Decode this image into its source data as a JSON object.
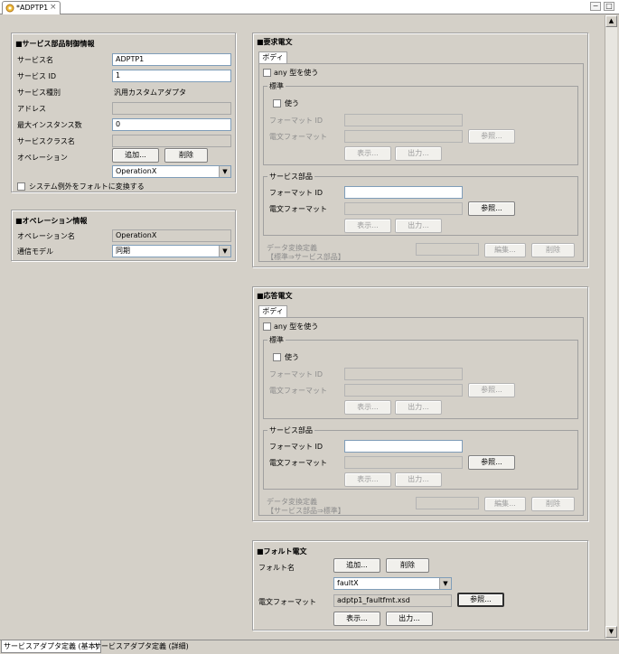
{
  "editor_tab": {
    "title": "*ADPTP1",
    "close_label": "×"
  },
  "service_info": {
    "title": "■サービス部品制御情報",
    "name_label": "サービス名",
    "name_value": "ADPTP1",
    "id_label": "サービス ID",
    "id_value": "1",
    "type_label": "サービス種別",
    "type_value": "汎用カスタムアダプタ",
    "address_label": "アドレス",
    "address_value": "",
    "max_instances_label": "最大インスタンス数",
    "max_instances_value": "0",
    "class_label": "サービスクラス名",
    "class_value": "",
    "operation_label": "オペレーション",
    "add_button": "追加...",
    "delete_button": "削除",
    "operation_selected": "OperationX",
    "fault_convert_label": "システム例外をフォルトに変換する"
  },
  "operation_info": {
    "title": "■オペレーション情報",
    "name_label": "オペレーション名",
    "name_value": "OperationX",
    "model_label": "通信モデル",
    "model_value": "同期"
  },
  "request": {
    "title": "■要求電文",
    "tab": "ボディ",
    "any_label": "any 型を使う",
    "standard": {
      "title": "標準",
      "use_label": "使う",
      "format_id_label": "フォーマット ID",
      "format_label": "電文フォーマット",
      "ref_button": "参照...",
      "show_button": "表示...",
      "output_button": "出力..."
    },
    "service_part": {
      "title": "サービス部品",
      "format_id_label": "フォーマット ID",
      "format_label": "電文フォーマット",
      "ref_button": "参照...",
      "show_button": "表示...",
      "output_button": "出力..."
    },
    "conv_line1": "データ変換定義",
    "conv_line2": "【標準⇒サービス部品】",
    "edit_button": "編集...",
    "delete_button": "削除"
  },
  "response": {
    "title": "■応答電文",
    "tab": "ボディ",
    "any_label": "any 型を使う",
    "standard": {
      "title": "標準",
      "use_label": "使う",
      "format_id_label": "フォーマット ID",
      "format_label": "電文フォーマット",
      "ref_button": "参照...",
      "show_button": "表示...",
      "output_button": "出力..."
    },
    "service_part": {
      "title": "サービス部品",
      "format_id_label": "フォーマット ID",
      "format_label": "電文フォーマット",
      "ref_button": "参照...",
      "show_button": "表示...",
      "output_button": "出力..."
    },
    "conv_line1": "データ変換定義",
    "conv_line2": "【サービス部品⇒標準】",
    "edit_button": "編集...",
    "delete_button": "削除"
  },
  "fault": {
    "title": "■フォルト電文",
    "name_label": "フォルト名",
    "add_button": "追加...",
    "delete_button": "削除",
    "selected": "faultX",
    "format_label": "電文フォーマット",
    "format_value": "adptp1_faultfmt.xsd",
    "ref_button": "参照...",
    "show_button": "表示...",
    "output_button": "出力..."
  },
  "bottom_tabs": [
    "サービスアダプタ定義 (基本)",
    "サービスアダプタ定義 (詳細)"
  ]
}
